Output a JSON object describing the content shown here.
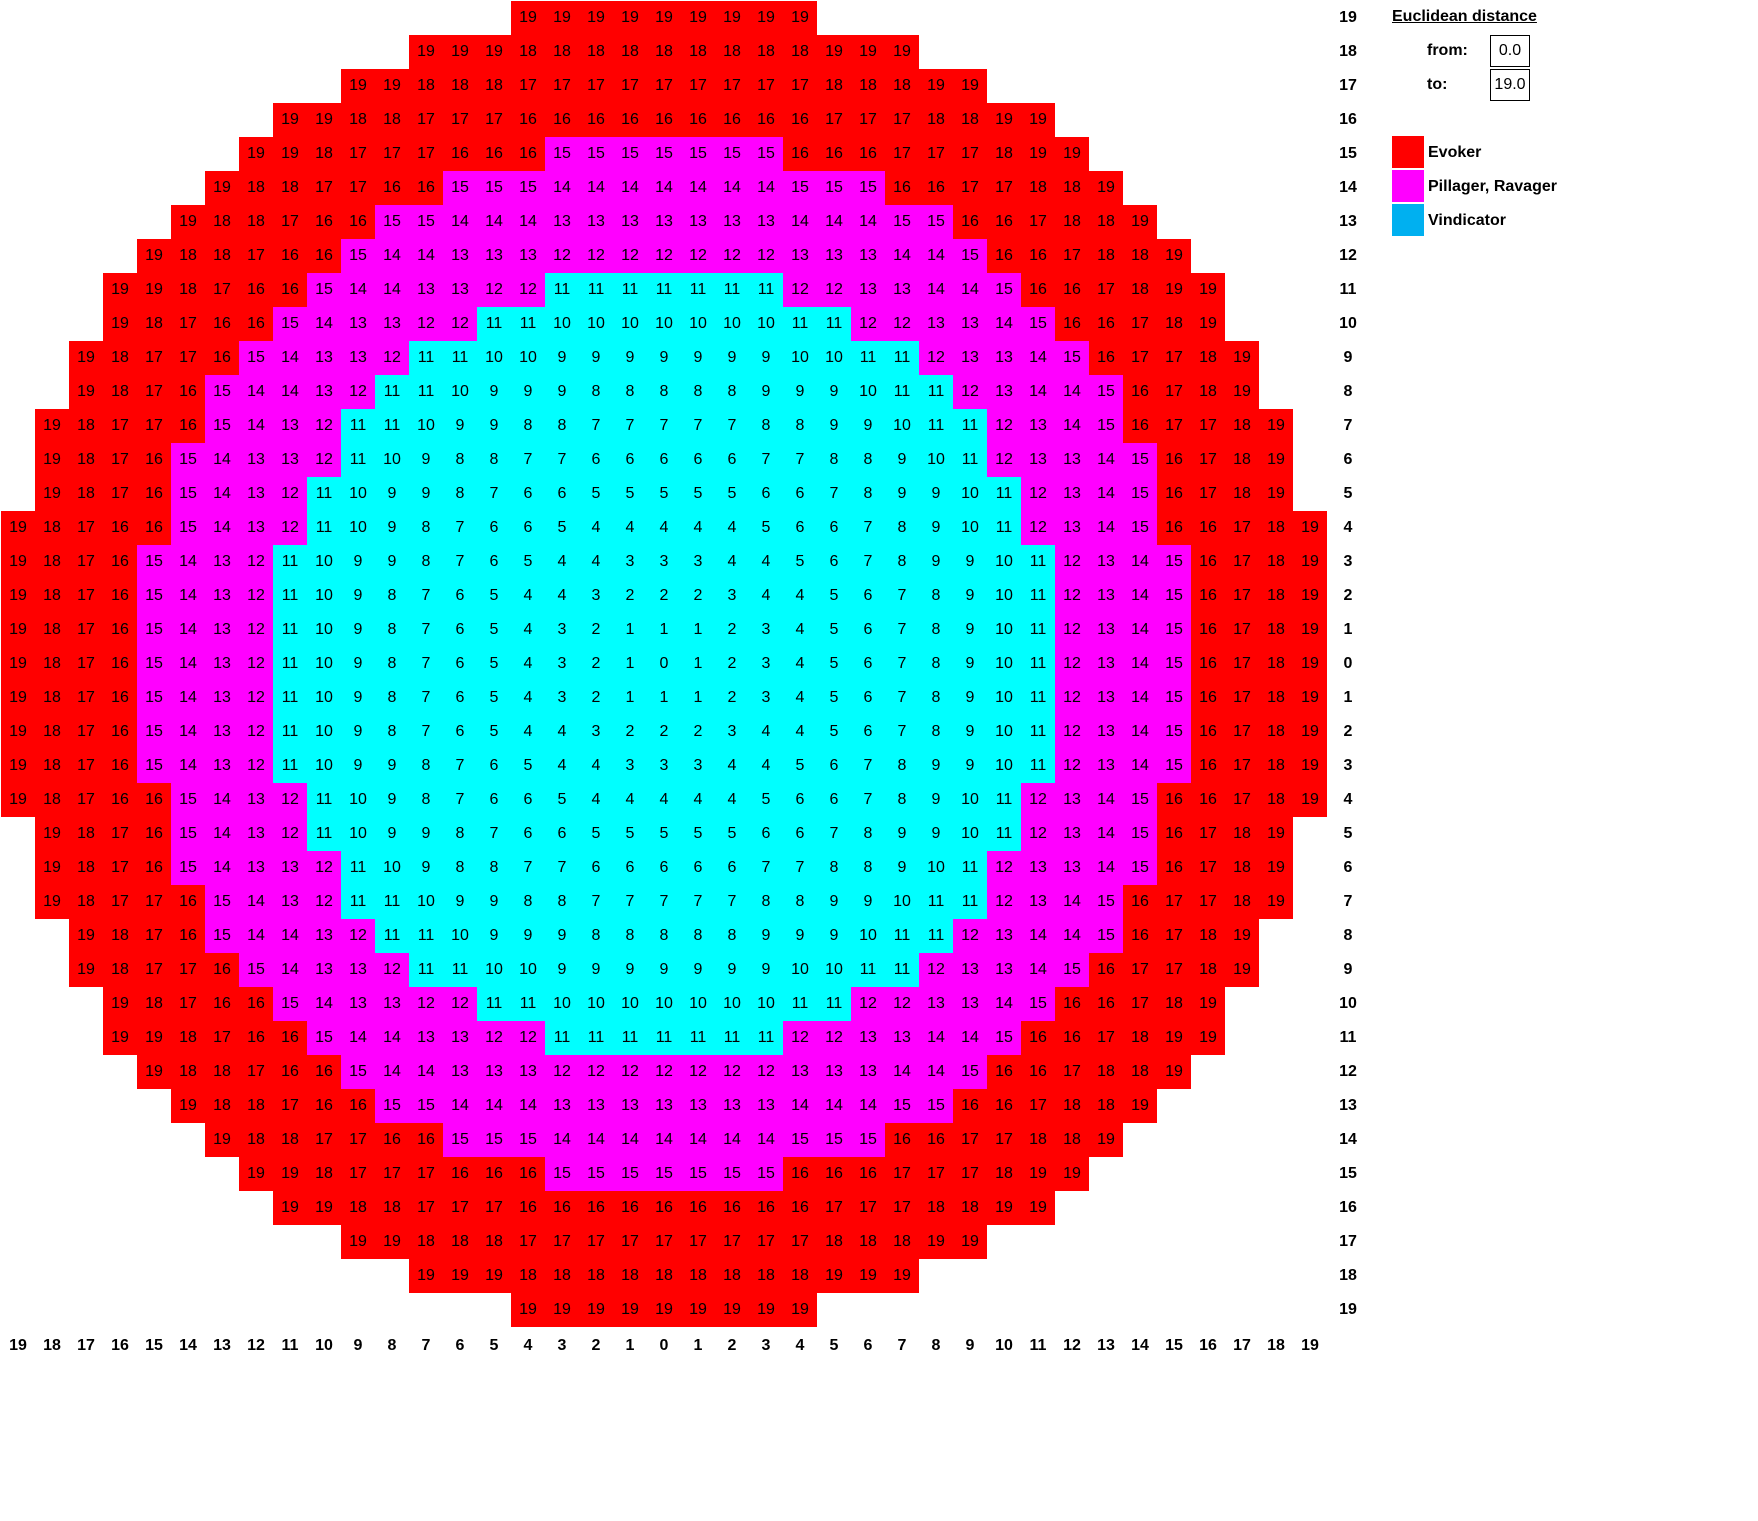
{
  "panel": {
    "title": "Euclidean distance",
    "from_label": "from:",
    "from_value": "0.0",
    "to_label": "to:",
    "to_value": "19.0"
  },
  "legend": [
    {
      "label": "Evoker",
      "color": "#ff0000"
    },
    {
      "label": "Pillager, Ravager",
      "color": "#ff00ff"
    },
    {
      "label": "Vindicator",
      "color": "#00b0f0"
    }
  ],
  "grid": {
    "radius": 19,
    "zone_colors": {
      "evoker": "#ff0000",
      "pillager": "#ff00ff",
      "vindicator": "#00ffff"
    },
    "zone_thresholds": {
      "vindicator_max": 11,
      "pillager_max": 15,
      "evoker_max": 19
    },
    "row_labels": [
      19,
      18,
      17,
      16,
      15,
      14,
      13,
      12,
      11,
      10,
      9,
      8,
      7,
      6,
      5,
      4,
      3,
      2,
      1,
      0,
      1,
      2,
      3,
      4,
      5,
      6,
      7,
      8,
      9,
      10,
      11,
      12,
      13,
      14,
      15,
      16,
      17,
      18,
      19
    ],
    "col_labels": [
      19,
      18,
      17,
      16,
      15,
      14,
      13,
      12,
      11,
      10,
      9,
      8,
      7,
      6,
      5,
      4,
      3,
      2,
      1,
      0,
      1,
      2,
      3,
      4,
      5,
      6,
      7,
      8,
      9,
      10,
      11,
      12,
      13,
      14,
      15,
      16,
      17,
      18,
      19
    ]
  }
}
